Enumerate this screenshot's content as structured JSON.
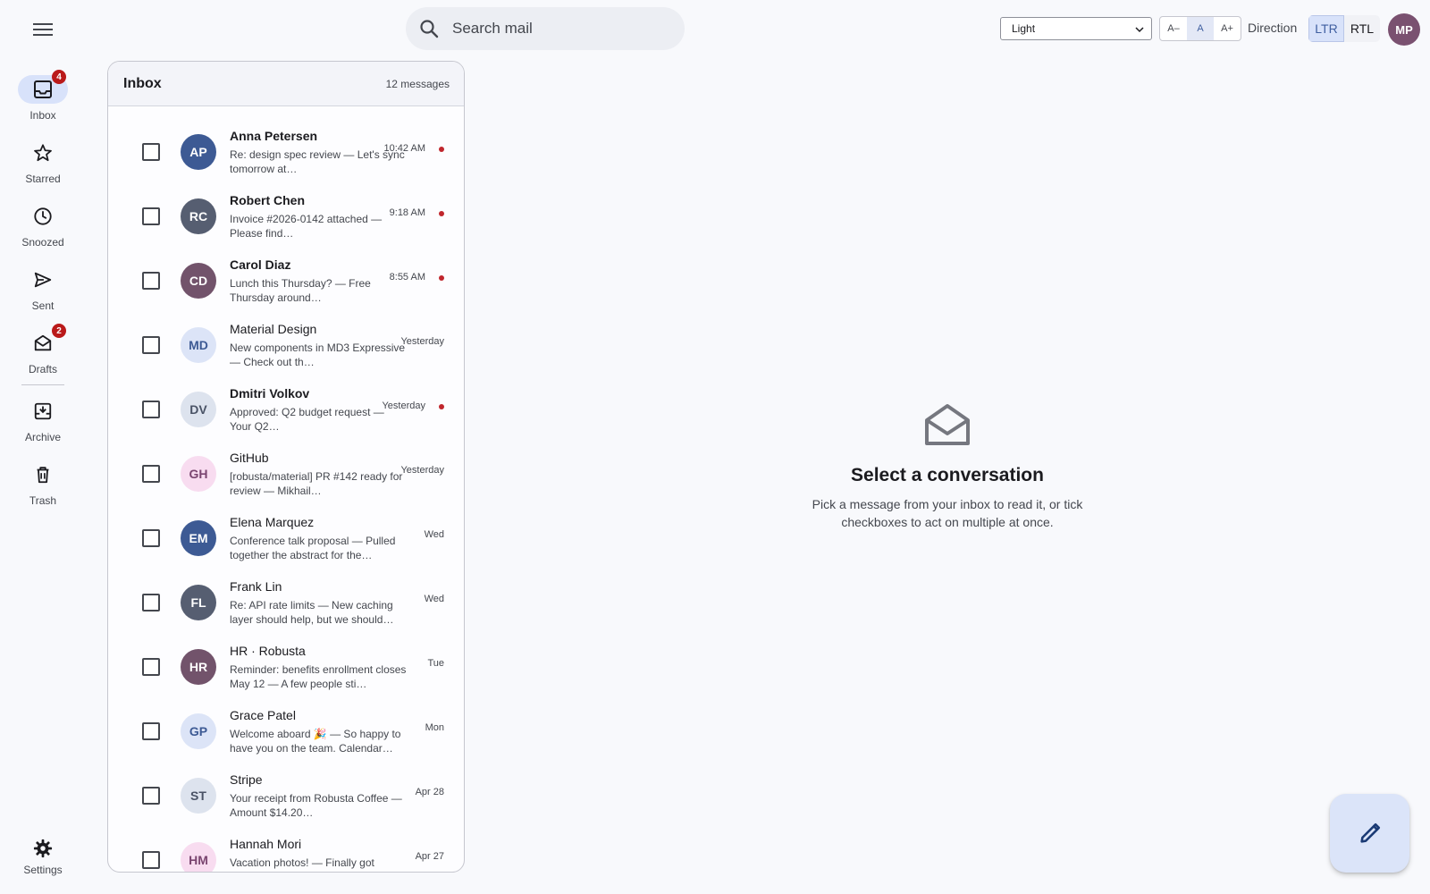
{
  "header": {
    "search_placeholder": "Search mail",
    "theme_value": "Light",
    "font_buttons": [
      "A–",
      "A",
      "A+"
    ],
    "direction_label": "Direction",
    "direction_ltr": "LTR",
    "direction_rtl": "RTL",
    "user_initials": "MP"
  },
  "nav": {
    "inbox": {
      "label": "Inbox",
      "badge": "4"
    },
    "starred": {
      "label": "Starred"
    },
    "snoozed": {
      "label": "Snoozed"
    },
    "sent": {
      "label": "Sent"
    },
    "drafts": {
      "label": "Drafts",
      "badge": "2"
    },
    "archive": {
      "label": "Archive"
    },
    "trash": {
      "label": "Trash"
    },
    "settings": {
      "label": "Settings"
    }
  },
  "inbox": {
    "title": "Inbox",
    "count": "12 messages",
    "messages": [
      {
        "initials": "AP",
        "sender": "Anna Petersen",
        "preview": "Re: design spec review — Let's sync tomorrow at…",
        "time": "10:42 AM",
        "unread": true,
        "avatar_bg": "#3d5a94",
        "avatar_fg": "#ffffff"
      },
      {
        "initials": "RC",
        "sender": "Robert Chen",
        "preview": "Invoice #2026-0142 attached — Please find…",
        "time": "9:18 AM",
        "unread": true,
        "avatar_bg": "#565e71",
        "avatar_fg": "#ffffff"
      },
      {
        "initials": "CD",
        "sender": "Carol Diaz",
        "preview": "Lunch this Thursday? — Free Thursday around…",
        "time": "8:55 AM",
        "unread": true,
        "avatar_bg": "#72536b",
        "avatar_fg": "#ffffff"
      },
      {
        "initials": "MD",
        "sender": "Material Design",
        "preview": "New components in MD3 Expressive — Check out th…",
        "time": "Yesterday",
        "unread": false,
        "avatar_bg": "#dce4f7",
        "avatar_fg": "#3d5a94"
      },
      {
        "initials": "DV",
        "sender": "Dmitri Volkov",
        "preview": "Approved: Q2 budget request — Your Q2…",
        "time": "Yesterday",
        "unread": true,
        "avatar_bg": "#dde3ee",
        "avatar_fg": "#4a5366"
      },
      {
        "initials": "GH",
        "sender": "GitHub",
        "preview": "[robusta/material] PR #142 ready for review — Mikhail…",
        "time": "Yesterday",
        "unread": false,
        "avatar_bg": "#f8dcf0",
        "avatar_fg": "#7a4570"
      },
      {
        "initials": "EM",
        "sender": "Elena Marquez",
        "preview": "Conference talk proposal — Pulled together the abstract for the…",
        "time": "Wed",
        "unread": false,
        "avatar_bg": "#3d5a94",
        "avatar_fg": "#ffffff"
      },
      {
        "initials": "FL",
        "sender": "Frank Lin",
        "preview": "Re: API rate limits — New caching layer should help, but we should…",
        "time": "Wed",
        "unread": false,
        "avatar_bg": "#565e71",
        "avatar_fg": "#ffffff"
      },
      {
        "initials": "HR",
        "sender": "HR · Robusta",
        "preview": "Reminder: benefits enrollment closes May 12 — A few people sti…",
        "time": "Tue",
        "unread": false,
        "avatar_bg": "#72536b",
        "avatar_fg": "#ffffff"
      },
      {
        "initials": "GP",
        "sender": "Grace Patel",
        "preview": "Welcome aboard 🎉 — So happy to have you on the team. Calendar…",
        "time": "Mon",
        "unread": false,
        "avatar_bg": "#dce4f7",
        "avatar_fg": "#3d5a94"
      },
      {
        "initials": "ST",
        "sender": "Stripe",
        "preview": "Your receipt from Robusta Coffee — Amount $14.20…",
        "time": "Apr 28",
        "unread": false,
        "avatar_bg": "#dde3ee",
        "avatar_fg": "#4a5366"
      },
      {
        "initials": "HM",
        "sender": "Hannah Mori",
        "preview": "Vacation photos! — Finally got around to sorting through the…",
        "time": "Apr 27",
        "unread": false,
        "avatar_bg": "#f8dcf0",
        "avatar_fg": "#7a4570"
      }
    ]
  },
  "empty_state": {
    "title": "Select a conversation",
    "body": "Pick a message from your inbox to read it, or tick checkboxes to act on multiple at once."
  },
  "colors": {
    "accent": "#3f5fa0",
    "active_pill": "#d8e2fa",
    "badge": "#ba1a1a",
    "unread_dot": "#c0262d",
    "fab": "#dbe4f9"
  }
}
